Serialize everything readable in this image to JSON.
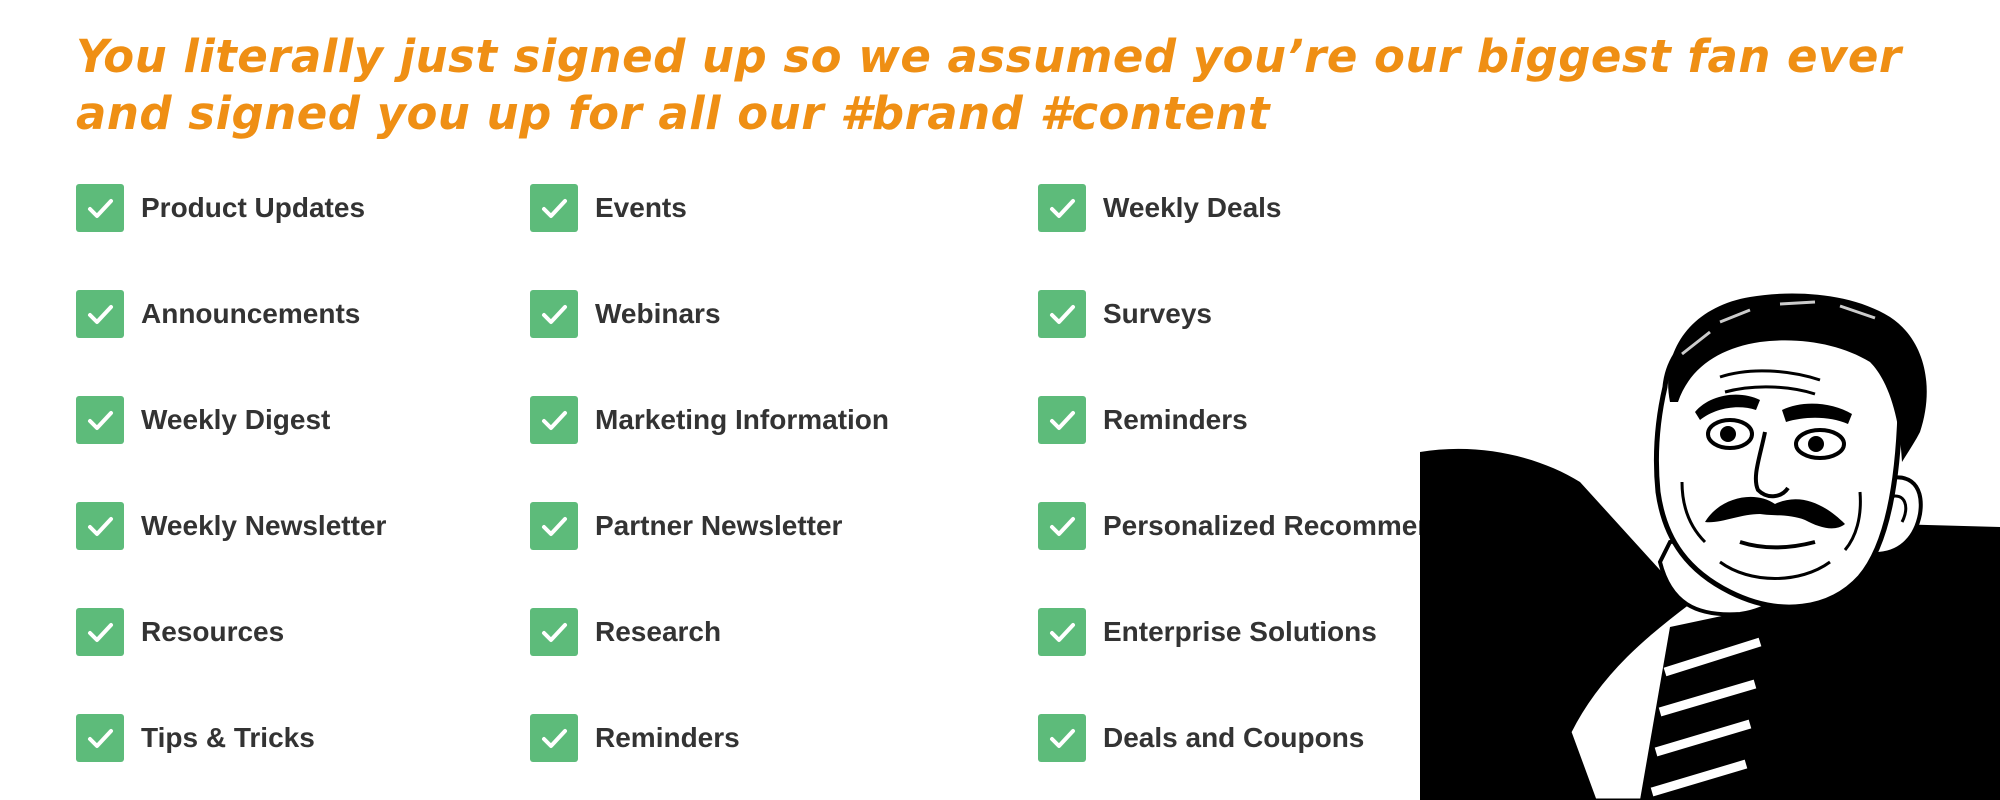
{
  "headline": {
    "line1": "You literally just signed up so we assumed you’re our biggest fan ever",
    "line2": "and signed you up for all our #brand #content"
  },
  "colors": {
    "headline": "#ef8f14",
    "check_fill": "#5dbb7a",
    "check_mark": "#ffffff",
    "label": "#333333",
    "meme_ink": "#000000"
  },
  "icons": {
    "checkbox": "check-icon",
    "meme": "meme-face-illustration"
  },
  "subscriptions": [
    {
      "label": "Product Updates",
      "checked": true
    },
    {
      "label": "Announcements",
      "checked": true
    },
    {
      "label": "Weekly Digest",
      "checked": true
    },
    {
      "label": "Weekly Newsletter",
      "checked": true
    },
    {
      "label": "Resources",
      "checked": true
    },
    {
      "label": "Tips & Tricks",
      "checked": true
    },
    {
      "label": "Events",
      "checked": true
    },
    {
      "label": "Webinars",
      "checked": true
    },
    {
      "label": "Marketing Information",
      "checked": true
    },
    {
      "label": "Partner Newsletter",
      "checked": true
    },
    {
      "label": "Research",
      "checked": true
    },
    {
      "label": "Reminders",
      "checked": true
    },
    {
      "label": "Weekly Deals",
      "checked": true
    },
    {
      "label": "Surveys",
      "checked": true
    },
    {
      "label": "Reminders",
      "checked": true
    },
    {
      "label": "Personalized Recommendations",
      "checked": true
    },
    {
      "label": "Enterprise Solutions",
      "checked": true
    },
    {
      "label": "Deals and Coupons",
      "checked": true
    }
  ]
}
